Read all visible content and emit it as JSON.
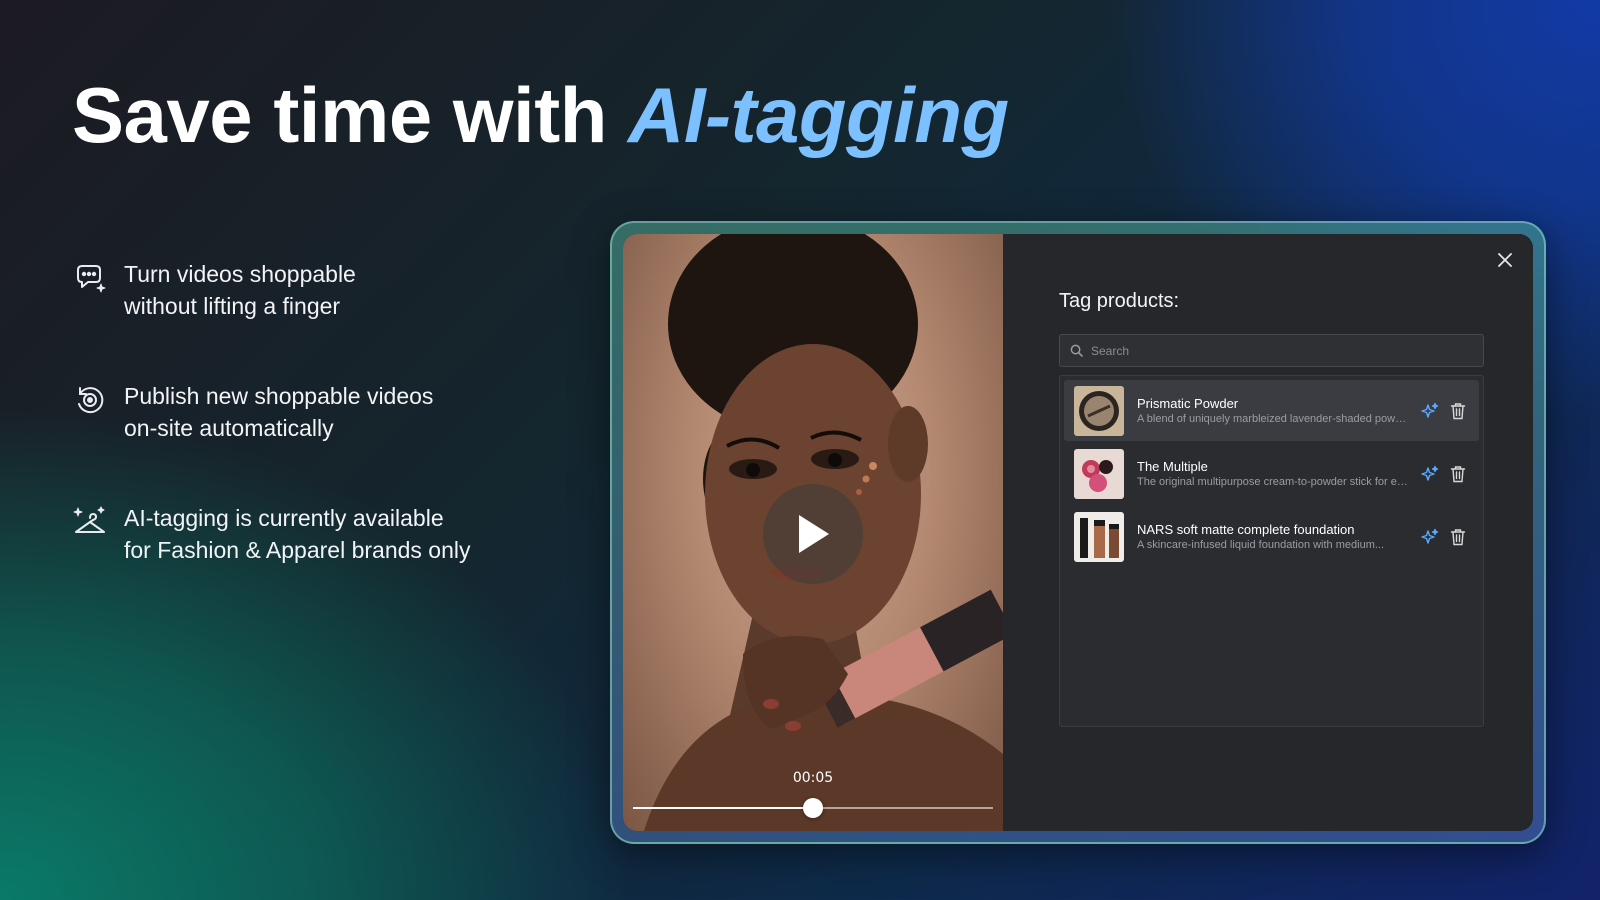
{
  "headline": {
    "lead": "Save time with ",
    "accent": "AI-tagging"
  },
  "colors": {
    "accent": "#7cc0ff",
    "ai_icon": "#5aa9ff",
    "panel_bg": "#25272b"
  },
  "features": [
    {
      "icon": "ai-chat-sparkle-icon",
      "line1": "Turn videos shoppable",
      "line2": "without lifting a finger"
    },
    {
      "icon": "auto-publish-cycle-icon",
      "line1": "Publish new shoppable videos",
      "line2": "on-site automatically"
    },
    {
      "icon": "hanger-sparkle-icon",
      "line1": "AI-tagging is currently available",
      "line2": "for Fashion & Apparel brands only"
    }
  ],
  "video": {
    "timestamp": "00:05",
    "progress_fraction": 0.5
  },
  "panel": {
    "title": "Tag products:",
    "search_placeholder": "Search",
    "products": [
      {
        "name": "Prismatic Powder",
        "description": "A blend of uniquely marbleized lavender-shaded powders...",
        "thumb": "powder-compact"
      },
      {
        "name": "The Multiple",
        "description": "The original multipurpose cream-to-powder stick for eyes...",
        "thumb": "multiple-sticks"
      },
      {
        "name": "NARS soft matte complete foundation",
        "description": "A skincare-infused liquid foundation with medium...",
        "thumb": "foundation-bottles"
      }
    ]
  }
}
